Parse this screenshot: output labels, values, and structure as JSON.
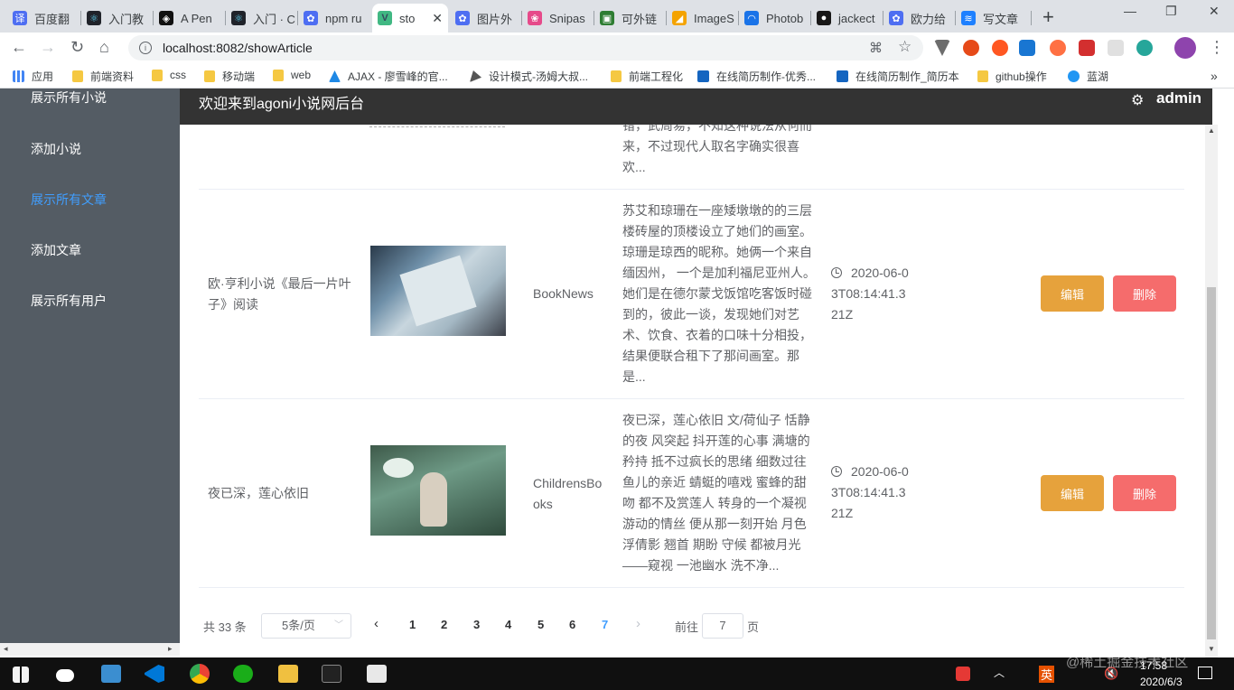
{
  "browser": {
    "tabs": [
      {
        "label": "百度翻",
        "color": "#4e6ef2",
        "glyph": "译"
      },
      {
        "label": "入门教",
        "color": "#20232a",
        "glyph": "⚛"
      },
      {
        "label": "A Pen",
        "color": "#111111",
        "glyph": "◈"
      },
      {
        "label": "入门 · C",
        "color": "#20232a",
        "glyph": "⚛"
      },
      {
        "label": "npm ru",
        "color": "#4e6ef2",
        "glyph": "✿"
      },
      {
        "label": "sto",
        "color": "#41b883",
        "glyph": "V",
        "close": "✕"
      },
      {
        "label": "图片外",
        "color": "#4e6ef2",
        "glyph": "✿"
      },
      {
        "label": "Snipas",
        "color": "#e64a8a",
        "glyph": "❀"
      },
      {
        "label": "可外链",
        "color": "#2e7d32",
        "glyph": "▣"
      },
      {
        "label": "ImageS",
        "color": "#f4a300",
        "glyph": "◢"
      },
      {
        "label": "Photob",
        "color": "#1a73e8",
        "glyph": "◠"
      },
      {
        "label": "jackect",
        "color": "#181717",
        "glyph": "●"
      },
      {
        "label": "欧力给",
        "color": "#4e6ef2",
        "glyph": "✿"
      },
      {
        "label": "写文章",
        "color": "#1e80ff",
        "glyph": "≋"
      }
    ],
    "new_tab": "+",
    "window_controls": [
      "—",
      "❐",
      "✕"
    ],
    "url": "localhost:8082/showArticle",
    "bookmarks": [
      {
        "label": "应用",
        "icon": "apps-grid-icon"
      },
      {
        "label": "前端资料",
        "icon": "folder-icon"
      },
      {
        "label": "css",
        "icon": "folder-icon"
      },
      {
        "label": "移动端",
        "icon": "folder-icon"
      },
      {
        "label": "web",
        "icon": "folder-icon"
      },
      {
        "label": "AJAX - 廖雪峰的官...",
        "icon": "rocket-icon"
      },
      {
        "label": "设计模式-汤姆大叔...",
        "icon": "pen-icon"
      },
      {
        "label": "前端工程化",
        "icon": "folder-icon"
      },
      {
        "label": "在线简历制作-优秀...",
        "icon": "site-icon"
      },
      {
        "label": "在线简历制作_简历本",
        "icon": "site-icon"
      },
      {
        "label": "github操作",
        "icon": "folder-icon"
      },
      {
        "label": "蓝湖",
        "icon": "site-icon"
      }
    ],
    "bookmarks_more": "»"
  },
  "sidebar": {
    "items": [
      {
        "label": "展示所有小说",
        "active": false
      },
      {
        "label": "添加小说",
        "active": false
      },
      {
        "label": "展示所有文章",
        "active": true
      },
      {
        "label": "添加文章",
        "active": false
      },
      {
        "label": "展示所有用户",
        "active": false
      }
    ]
  },
  "header": {
    "title": "欢迎来到agoni小说网后台",
    "user": "admin"
  },
  "table": {
    "partial_row": {
      "summary_lines": [
        "错，武周易，不知这种说法从何而",
        "来，不过现代人取名字确实很喜",
        "欢..."
      ]
    },
    "rows": [
      {
        "title": "欧·亨利小说《最后一片叶子》阅读",
        "category": "BookNews",
        "summary": "苏艾和琼珊在一座矮墩墩的的三层楼砖屋的顶楼设立了她们的画室。琼珊是琼西的昵称。她俩一个来自缅因州， 一个是加利福尼亚州人。她们是在德尔蒙戈饭馆吃客饭时碰到的，彼此一谈，发现她们对艺术、饮食、衣着的口味十分相投，结果便联合租下了那间画室。那是...",
        "date": "2020-06-03T08:14:41.321Z",
        "edit": "编辑",
        "delete": "删除"
      },
      {
        "title": "夜已深，莲心依旧",
        "category": "ChildrensBooks",
        "summary": "夜已深，莲心依旧 文/荷仙子 恬静的夜 风突起 抖开莲的心事 满塘的矜持 抵不过疯长的思绪 细数过往 鱼儿的亲近 蜻蜓的嘻戏 蜜蜂的甜吻 都不及赏莲人 转身的一个凝视 游动的情丝 便从那一刻开始 月色浮倩影 翘首 期盼 守候 都被月光——窥视 一池幽水 洗不净...",
        "date": "2020-06-03T08:14:41.321Z",
        "edit": "编辑",
        "delete": "删除"
      }
    ]
  },
  "pagination": {
    "total": "共 33 条",
    "page_size": "5条/页",
    "prev": "‹",
    "next": "›",
    "pages": [
      "1",
      "2",
      "3",
      "4",
      "5",
      "6",
      "7"
    ],
    "current": 7,
    "goto_label": "前往",
    "goto_value": "7",
    "page_suffix": "页"
  },
  "taskbar": {
    "ime": "英",
    "time": "17:58",
    "date": "2020/6/3"
  },
  "watermark": "@稀土掘金技术社区"
}
